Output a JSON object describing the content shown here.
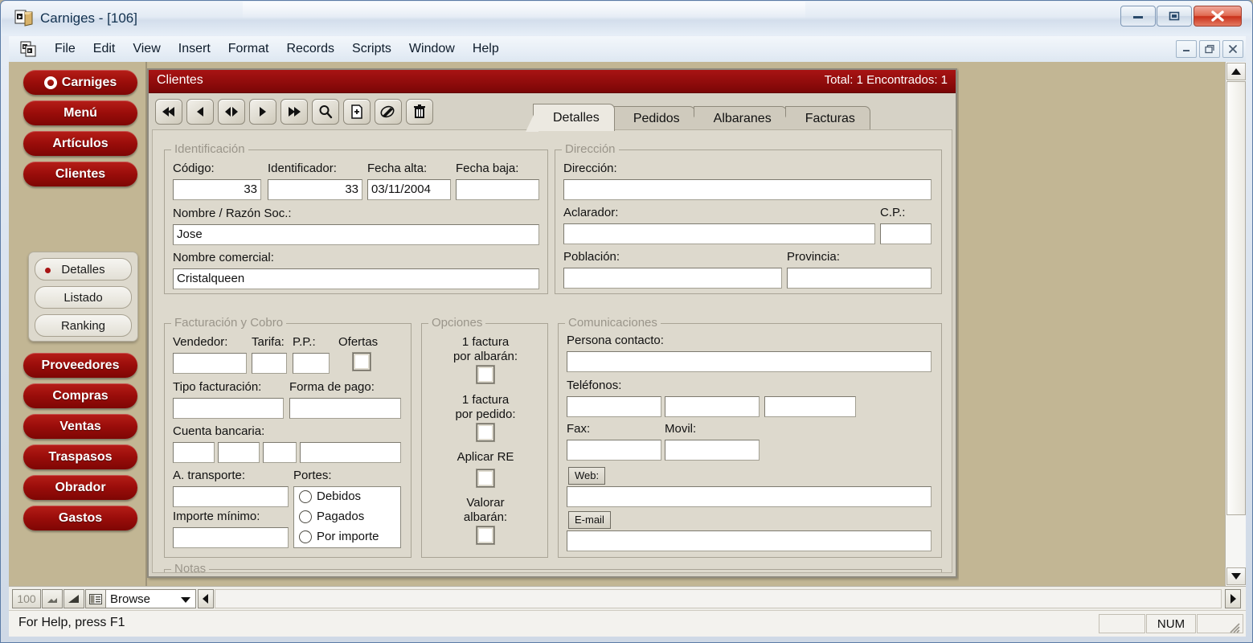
{
  "window": {
    "title": "Carniges - [106]",
    "icon": "app-document-icon",
    "controls": {
      "minimize": "minimize-icon",
      "maximize": "maximize-icon",
      "close": "close-icon"
    }
  },
  "menubar": {
    "icon": "mdi-document-icon",
    "items": [
      "File",
      "Edit",
      "View",
      "Insert",
      "Format",
      "Records",
      "Scripts",
      "Window",
      "Help"
    ],
    "mdi_controls": {
      "minimize": "mdi-minimize-icon",
      "restore": "mdi-restore-icon",
      "close": "mdi-close-icon"
    }
  },
  "sidebar": {
    "main_items": [
      {
        "label": "Carniges",
        "has_logo": true
      },
      {
        "label": "Menú",
        "has_logo": false
      },
      {
        "label": "Artículos",
        "has_logo": false
      },
      {
        "label": "Clientes",
        "has_logo": false
      }
    ],
    "sub_items": [
      {
        "label": "Detalles",
        "selected": true
      },
      {
        "label": "Listado",
        "selected": false
      },
      {
        "label": "Ranking",
        "selected": false
      }
    ],
    "bottom_items": [
      {
        "label": "Proveedores"
      },
      {
        "label": "Compras"
      },
      {
        "label": "Ventas"
      },
      {
        "label": "Traspasos"
      },
      {
        "label": "Obrador"
      },
      {
        "label": "Gastos"
      }
    ]
  },
  "form": {
    "header_title": "Clientes",
    "header_total": "Total: 1 Encontrados: 1",
    "toolbar": [
      {
        "icon": "first-record-icon",
        "name": "first-record-button"
      },
      {
        "icon": "previous-record-icon",
        "name": "previous-record-button"
      },
      {
        "icon": "flip-record-icon",
        "name": "flip-record-button"
      },
      {
        "icon": "next-record-icon",
        "name": "next-record-button"
      },
      {
        "icon": "last-record-icon",
        "name": "last-record-button"
      },
      {
        "icon": "search-icon",
        "name": "find-button"
      },
      {
        "icon": "new-record-icon",
        "name": "new-record-button"
      },
      {
        "icon": "edit-pencil-icon",
        "name": "edit-button"
      },
      {
        "icon": "trash-icon",
        "name": "delete-button"
      }
    ],
    "tabs": [
      {
        "label": "Detalles",
        "active": true
      },
      {
        "label": "Pedidos",
        "active": false
      },
      {
        "label": "Albaranes",
        "active": false
      },
      {
        "label": "Facturas",
        "active": false
      }
    ]
  },
  "identificacion": {
    "title": "Identificación",
    "codigo_label": "Código:",
    "codigo_value": "33",
    "identificador_label": "Identificador:",
    "identificador_value": "33",
    "fecha_alta_label": "Fecha alta:",
    "fecha_alta_value": "03/11/2004",
    "fecha_baja_label": "Fecha baja:",
    "fecha_baja_value": "",
    "nombre_razon_label": "Nombre / Razón Soc.:",
    "nombre_razon_value": "Jose",
    "nombre_comercial_label": "Nombre comercial:",
    "nombre_comercial_value": "Cristalqueen"
  },
  "direccion": {
    "title": "Dirección",
    "direccion_label": "Dirección:",
    "direccion_value": "",
    "aclarador_label": "Aclarador:",
    "aclarador_value": "",
    "cp_label": "C.P.:",
    "cp_value": "",
    "poblacion_label": "Población:",
    "poblacion_value": "",
    "provincia_label": "Provincia:",
    "provincia_value": ""
  },
  "facturacion": {
    "title": "Facturación y Cobro",
    "vendedor_label": "Vendedor:",
    "vendedor_value": "",
    "tarifa_label": "Tarifa:",
    "tarifa_value": "",
    "pp_label": "P.P.:",
    "pp_value": "",
    "ofertas_label": "Ofertas",
    "ofertas_checked": false,
    "tipo_facturacion_label": "Tipo facturación:",
    "tipo_facturacion_value": "",
    "forma_pago_label": "Forma de pago:",
    "forma_pago_value": "",
    "cuenta_bancaria_label": "Cuenta bancaria:",
    "cuenta_bancaria_values": [
      "",
      "",
      "",
      ""
    ],
    "a_transporte_label": "A. transporte:",
    "a_transporte_value": "",
    "importe_minimo_label": "Importe mínimo:",
    "importe_minimo_value": "",
    "portes_label": "Portes:",
    "portes_options": [
      {
        "label": "Debidos",
        "selected": false
      },
      {
        "label": "Pagados",
        "selected": false
      },
      {
        "label": "Por importe",
        "selected": false
      }
    ]
  },
  "opciones": {
    "title": "Opciones",
    "items": [
      {
        "label_line1": "1 factura",
        "label_line2": "por albarán:",
        "checked": false
      },
      {
        "label_line1": "1 factura",
        "label_line2": "por pedido:",
        "checked": false
      },
      {
        "label_line1": "Aplicar RE",
        "label_line2": "",
        "checked": false
      },
      {
        "label_line1": "Valorar",
        "label_line2": "albarán:",
        "checked": false
      }
    ]
  },
  "comunicaciones": {
    "title": "Comunicaciones",
    "persona_contacto_label": "Persona contacto:",
    "persona_contacto_value": "",
    "telefonos_label": "Teléfonos:",
    "telefonos_values": [
      "",
      "",
      ""
    ],
    "fax_label": "Fax:",
    "fax_value": "",
    "movil_label": "Movil:",
    "movil_value": "",
    "web_button": "Web:",
    "web_value": "",
    "email_button": "E-mail",
    "email_value": ""
  },
  "notas": {
    "title": "Notas"
  },
  "statusstrip": {
    "zoom_level": "100",
    "zoom_out_icon": "zoom-out-icon",
    "zoom_in_icon": "zoom-in-icon",
    "toggle_window_icon": "toggle-window-icon",
    "mode": "Browse",
    "scroll_left_icon": "scroll-left-icon",
    "scroll_right_icon": "scroll-right-icon"
  },
  "statusbar": {
    "help_text": "For Help, press F1",
    "pane1": "",
    "num_indicator": "NUM",
    "pane3": ""
  },
  "colors": {
    "brand_red": "#a81414",
    "nav_red": "#9a0d0a",
    "panel_bg": "#ddd9cd",
    "desktop": "#c2b694",
    "accent_dot": "#a81414"
  }
}
